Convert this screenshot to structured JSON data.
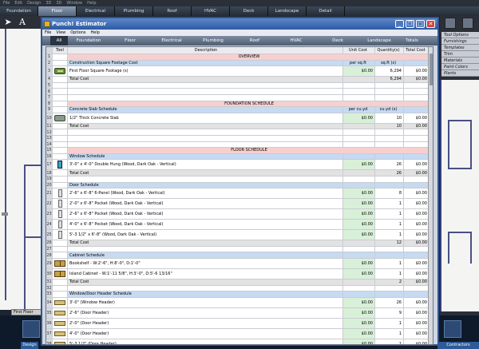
{
  "app": {
    "menu": [
      "File",
      "Edit",
      "Design",
      "3D",
      "3D",
      "Window",
      "Help"
    ],
    "tabs": [
      {
        "label": "Foundation",
        "active": false
      },
      {
        "label": "Floor",
        "active": true
      },
      {
        "label": "Electrical",
        "active": false
      },
      {
        "label": "Plumbing",
        "active": false
      },
      {
        "label": "Roof",
        "active": false
      },
      {
        "label": "HVAC",
        "active": false
      },
      {
        "label": "Deck",
        "active": false
      },
      {
        "label": "Landscape",
        "active": false
      },
      {
        "label": "Detail",
        "active": false
      }
    ],
    "right_list": [
      "Tool Options",
      "Furnishings",
      "Templates",
      "Trim",
      "Materials",
      "Paint Colors",
      "Plants"
    ],
    "floor_tab": "First Floor",
    "design_tab": "Design",
    "contractors_tab": "Contractors"
  },
  "estimator": {
    "title": "Punch! Estimator",
    "menu": [
      "File",
      "View",
      "Options",
      "Help"
    ],
    "tabs": [
      {
        "label": "All",
        "active": true
      },
      {
        "label": "Foundation",
        "active": false
      },
      {
        "label": "Floor",
        "active": false
      },
      {
        "label": "Electrical",
        "active": false
      },
      {
        "label": "Plumbing",
        "active": false
      },
      {
        "label": "Roof",
        "active": false
      },
      {
        "label": "HVAC",
        "active": false
      },
      {
        "label": "Deck",
        "active": false
      },
      {
        "label": "Landscape",
        "active": false
      },
      {
        "label": "Totals",
        "active": false
      }
    ],
    "columns": {
      "tool": "Tool",
      "description": "Description",
      "unit": "Unit Cost",
      "qty": "Quantity(s)",
      "total": "Total Cost"
    },
    "rows": [
      {
        "num": "1",
        "type": "section",
        "desc": "OVERVIEW"
      },
      {
        "num": "2",
        "type": "sub",
        "desc": "Construction Square Footage Cost",
        "unit": "per sq.ft",
        "qty": "sq.ft (s)",
        "total": ""
      },
      {
        "num": "3",
        "type": "item",
        "icon": "floor",
        "desc": "First Floor Square Footage (s)",
        "unit": "$0.00",
        "qty": "6,294",
        "total": "$0.00"
      },
      {
        "num": "4",
        "type": "total",
        "desc": "Total Cost",
        "unit": "",
        "qty": "6,294",
        "total": "$0.00"
      },
      {
        "num": "5",
        "type": "blank"
      },
      {
        "num": "6",
        "type": "blank"
      },
      {
        "num": "7",
        "type": "blank"
      },
      {
        "num": "8",
        "type": "section",
        "desc": "FOUNDATION SCHEDULE"
      },
      {
        "num": "9",
        "type": "sub",
        "desc": "Concrete Slab Schedule",
        "unit": "per cu.yd",
        "qty": "cu.yd (s)",
        "total": ""
      },
      {
        "num": "10",
        "type": "item",
        "icon": "slab",
        "desc": "1/2\" Thick Concrete Slab",
        "unit": "$0.00",
        "qty": "10",
        "total": "$0.00"
      },
      {
        "num": "11",
        "type": "total",
        "desc": "Total Cost",
        "unit": "",
        "qty": "10",
        "total": "$0.00"
      },
      {
        "num": "12",
        "type": "blank"
      },
      {
        "num": "13",
        "type": "blank"
      },
      {
        "num": "14",
        "type": "blank"
      },
      {
        "num": "15",
        "type": "section",
        "desc": "FLOOR SCHEDULE"
      },
      {
        "num": "16",
        "type": "sub",
        "desc": "Window Schedule",
        "unit": "",
        "qty": "",
        "total": ""
      },
      {
        "num": "17",
        "type": "item",
        "icon": "window",
        "desc": "3'-0\" x 4'-0\" Double Hung (Wood, Dark Oak - Vertical)",
        "unit": "$0.00",
        "qty": "26",
        "total": "$0.00"
      },
      {
        "num": "18",
        "type": "total",
        "desc": "Total Cost",
        "unit": "",
        "qty": "26",
        "total": "$0.00"
      },
      {
        "num": "19",
        "type": "blank"
      },
      {
        "num": "20",
        "type": "sub",
        "desc": "Door Schedule",
        "unit": "",
        "qty": "",
        "total": ""
      },
      {
        "num": "21",
        "type": "item",
        "icon": "door",
        "desc": "2'-6\" x 6'-8\" 6-Panel (Wood, Dark Oak - Vertical)",
        "unit": "$0.00",
        "qty": "8",
        "total": "$0.00"
      },
      {
        "num": "22",
        "type": "item",
        "icon": "door",
        "desc": "2'-0\" x 6'-8\" Pocket (Wood, Dark Oak - Vertical)",
        "unit": "$0.00",
        "qty": "1",
        "total": "$0.00"
      },
      {
        "num": "23",
        "type": "item",
        "icon": "door",
        "desc": "2'-6\" x 6'-8\" Pocket (Wood, Dark Oak - Vertical)",
        "unit": "$0.00",
        "qty": "1",
        "total": "$0.00"
      },
      {
        "num": "24",
        "type": "item",
        "icon": "door",
        "desc": "4'-0\" x 6'-8\" Pocket (Wood, Dark Oak - Vertical)",
        "unit": "$0.00",
        "qty": "1",
        "total": "$0.00"
      },
      {
        "num": "25",
        "type": "item",
        "icon": "door",
        "desc": "5'-3 1/2\" x 6'-8\" (Wood, Dark Oak - Vertical)",
        "unit": "$0.00",
        "qty": "1",
        "total": "$0.00"
      },
      {
        "num": "26",
        "type": "total",
        "desc": "Total Cost",
        "unit": "",
        "qty": "12",
        "total": "$0.00"
      },
      {
        "num": "27",
        "type": "blank"
      },
      {
        "num": "28",
        "type": "sub",
        "desc": "Cabinet Schedule",
        "unit": "",
        "qty": "",
        "total": ""
      },
      {
        "num": "29",
        "type": "item",
        "icon": "cabinet",
        "desc": "Bookshelf - W:2'-6\", H:8'-0\", D:1'-0\"",
        "unit": "$0.00",
        "qty": "1",
        "total": "$0.00"
      },
      {
        "num": "30",
        "type": "item",
        "icon": "cabinet",
        "desc": "Island Cabinet - W:1'-11 5/8\", H:3'-0\", D:5'-6 13/16\"",
        "unit": "$0.00",
        "qty": "1",
        "total": "$0.00"
      },
      {
        "num": "31",
        "type": "total",
        "desc": "Total Cost",
        "unit": "",
        "qty": "2",
        "total": "$0.00"
      },
      {
        "num": "32",
        "type": "blank"
      },
      {
        "num": "33",
        "type": "sub",
        "desc": "Window/Door Header Schedule",
        "unit": "",
        "qty": "",
        "total": ""
      },
      {
        "num": "34",
        "type": "item",
        "icon": "header-ico",
        "desc": "3'-0\" (Window Header)",
        "unit": "$0.00",
        "qty": "26",
        "total": "$0.00"
      },
      {
        "num": "35",
        "type": "item",
        "icon": "header-ico",
        "desc": "2'-6\" (Door Header)",
        "unit": "$0.00",
        "qty": "9",
        "total": "$0.00"
      },
      {
        "num": "36",
        "type": "item",
        "icon": "header-ico",
        "desc": "2'-0\" (Door Header)",
        "unit": "$0.00",
        "qty": "1",
        "total": "$0.00"
      },
      {
        "num": "37",
        "type": "item",
        "icon": "header-ico",
        "desc": "4'-0\" (Door Header)",
        "unit": "$0.00",
        "qty": "1",
        "total": "$0.00"
      },
      {
        "num": "38",
        "type": "item",
        "icon": "header-ico",
        "desc": "5'-3 1/2\" (Door Header)",
        "unit": "$0.00",
        "qty": "1",
        "total": "$0.00"
      }
    ]
  }
}
